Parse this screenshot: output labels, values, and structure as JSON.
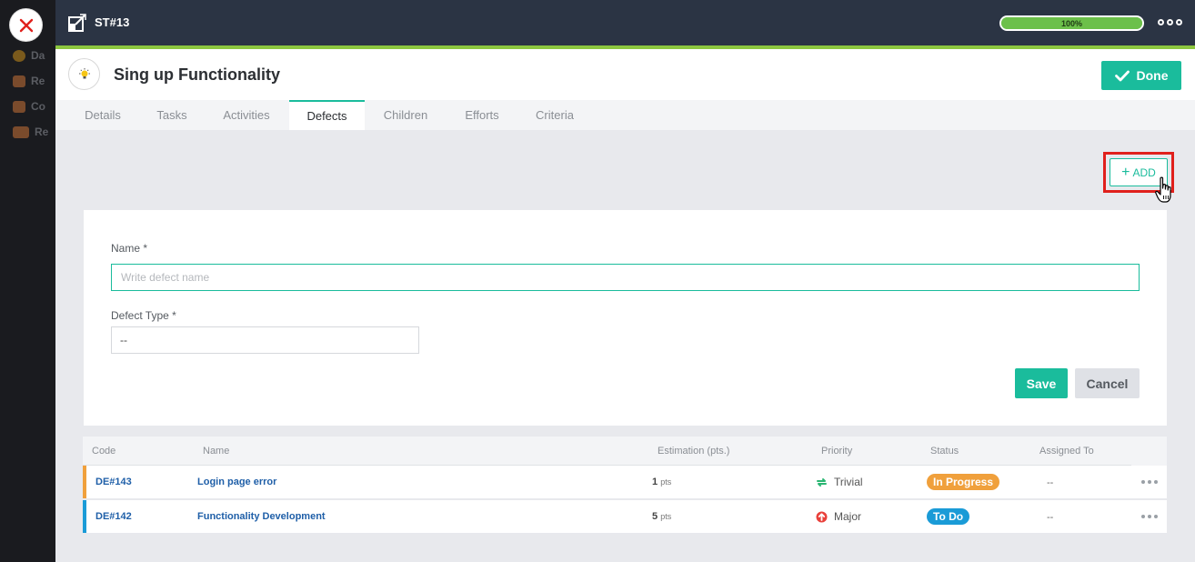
{
  "background_app": {
    "items": [
      {
        "label": "Da",
        "icon": "dashboard-icon"
      },
      {
        "label": "Re",
        "icon": "user-icon"
      },
      {
        "label": "Co",
        "icon": "calendar-icon"
      },
      {
        "label": "Re",
        "icon": "users-icon"
      }
    ]
  },
  "topbar": {
    "story_code": "ST#13",
    "progress_value": 1.0,
    "progress_label": "100%"
  },
  "header": {
    "title": "Sing up Functionality",
    "done_label": "Done"
  },
  "tabs": [
    {
      "label": "Details"
    },
    {
      "label": "Tasks"
    },
    {
      "label": "Activities"
    },
    {
      "label": "Defects",
      "active": true
    },
    {
      "label": "Children"
    },
    {
      "label": "Efforts"
    },
    {
      "label": "Criteria"
    }
  ],
  "add_button": {
    "label": "ADD"
  },
  "form": {
    "name_label": "Name",
    "name_placeholder": "Write defect name",
    "type_label": "Defect Type",
    "type_value": "--",
    "required_mark": "*",
    "save_label": "Save",
    "cancel_label": "Cancel"
  },
  "table": {
    "columns": [
      "Code",
      "Name",
      "Estimation (pts.)",
      "Priority",
      "Status",
      "Assigned To"
    ],
    "rows": [
      {
        "code": "DE#143",
        "name": "Login page error",
        "estimation": "1",
        "unit": "pts",
        "priority": "Trivial",
        "status": "In Progress",
        "assigned": "--"
      },
      {
        "code": "DE#142",
        "name": "Functionality Development",
        "estimation": "5",
        "unit": "pts",
        "priority": "Major",
        "status": "To Do",
        "assigned": "--"
      }
    ]
  },
  "colors": {
    "accent": "#1abc9c",
    "topbar": "#2b3444",
    "progress": "#6cc04a",
    "in_progress": "#f0a03c",
    "to_do": "#1a9bd7",
    "row_bar_1": "#f0a03c",
    "row_bar_2": "#1a9bd7",
    "highlight": "#e0201c"
  }
}
